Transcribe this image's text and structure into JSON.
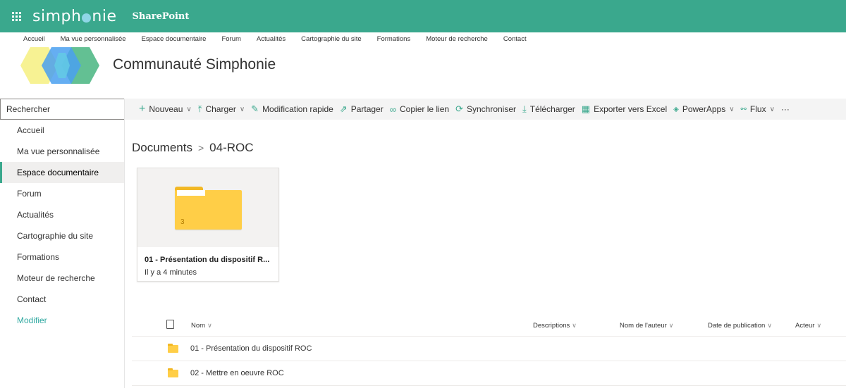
{
  "suitebar": {
    "brand_left": "simph",
    "brand_right": "nie",
    "product": "SharePoint",
    "color": "#3aa88d"
  },
  "topnav": [
    "Accueil",
    "Ma vue personnalisée",
    "Espace documentaire",
    "Forum",
    "Actualités",
    "Cartographie du site",
    "Formations",
    "Moteur de recherche",
    "Contact"
  ],
  "site": {
    "title": "Communauté Simphonie"
  },
  "leftnav": {
    "search_placeholder": "Rechercher",
    "items": [
      "Accueil",
      "Ma vue personnalisée",
      "Espace documentaire",
      "Forum",
      "Actualités",
      "Cartographie du site",
      "Formations",
      "Moteur de recherche",
      "Contact"
    ],
    "active": "Espace documentaire",
    "edit_label": "Modifier"
  },
  "commandbar": {
    "new": "Nouveau",
    "upload": "Charger",
    "quick_edit": "Modification rapide",
    "share": "Partager",
    "copy_link": "Copier le lien",
    "sync": "Synchroniser",
    "download": "Télécharger",
    "export_excel": "Exporter vers Excel",
    "powerapps": "PowerApps",
    "flow": "Flux",
    "more": "···"
  },
  "breadcrumb": {
    "root": "Documents",
    "separator": ">",
    "current": "04-ROC"
  },
  "tile": {
    "name": "01 - Présentation du dispositif R...",
    "modified": "Il y a 4 minutes",
    "item_count": "3"
  },
  "list": {
    "columns": {
      "name": "Nom",
      "descriptions": "Descriptions",
      "author": "Nom de l'auteur",
      "published": "Date de publication",
      "actor": "Acteur"
    },
    "rows": [
      {
        "name": "01 - Présentation du dispositif ROC"
      },
      {
        "name": "02 - Mettre en oeuvre ROC"
      }
    ]
  }
}
